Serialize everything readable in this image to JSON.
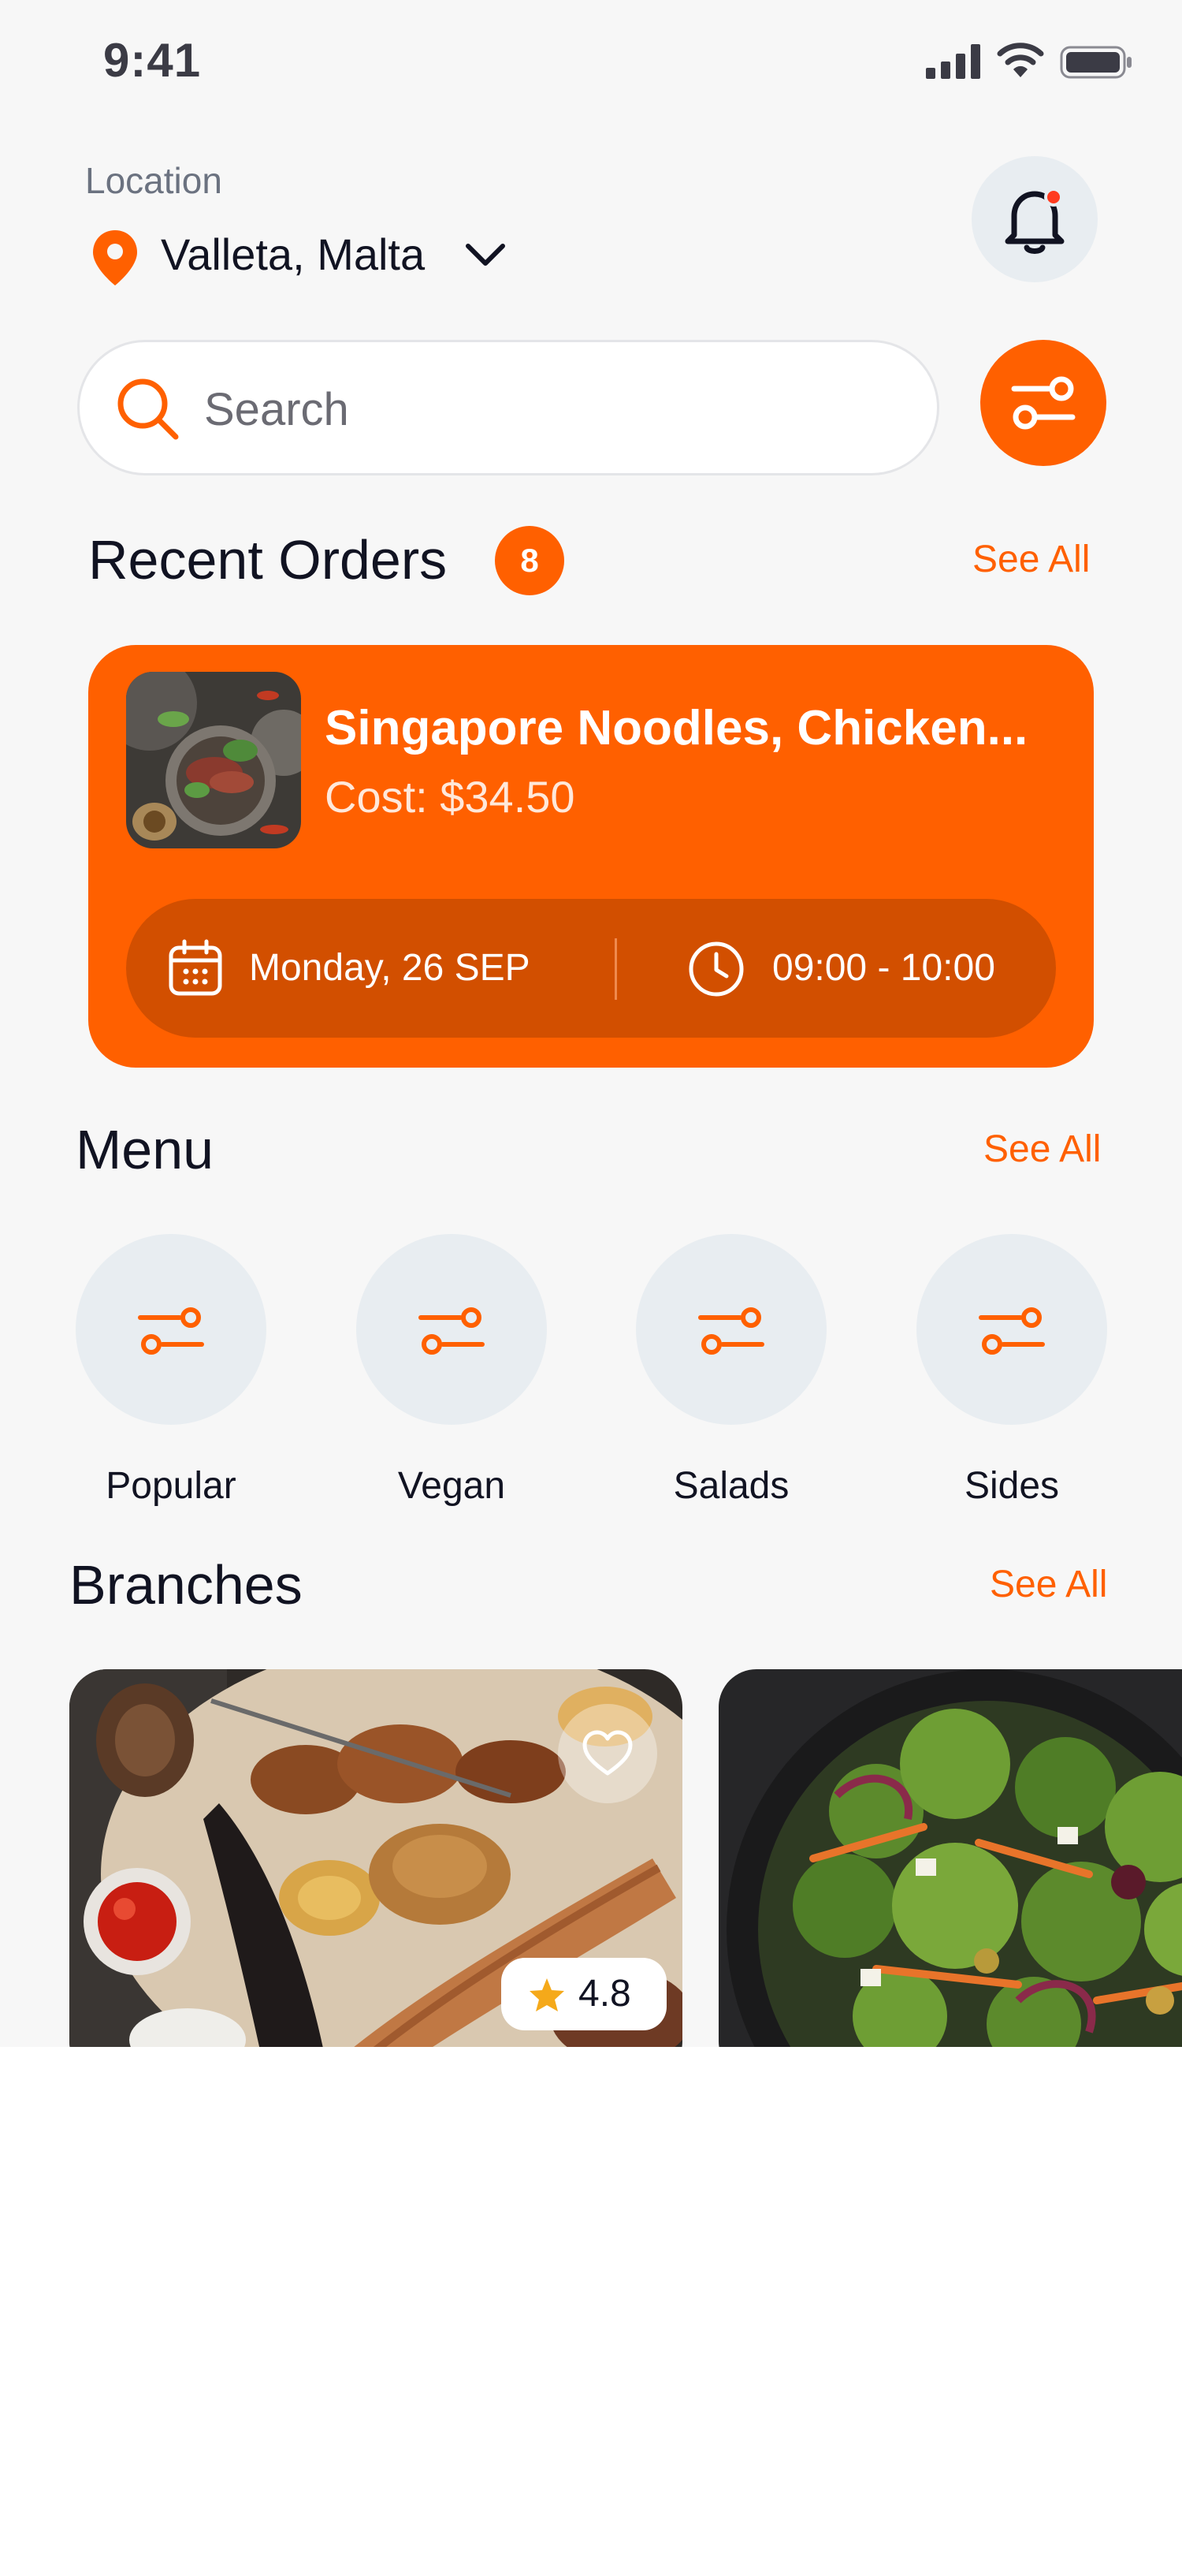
{
  "status_bar": {
    "time": "9:41"
  },
  "location": {
    "label": "Location",
    "value": "Valleta, Malta"
  },
  "search": {
    "placeholder": "Search"
  },
  "recent_orders": {
    "title": "Recent Orders",
    "count": "8",
    "see_all": "See All",
    "order": {
      "title": "Singapore Noodles, Chicken...",
      "cost": "Cost: $34.50",
      "date": "Monday, 26 SEP",
      "time": "09:00 - 10:00"
    }
  },
  "menu": {
    "title": "Menu",
    "see_all": "See All",
    "items": [
      {
        "label": "Popular"
      },
      {
        "label": "Vegan"
      },
      {
        "label": "Salads"
      },
      {
        "label": "Sides"
      }
    ]
  },
  "branches": {
    "title": "Branches",
    "see_all": "See All",
    "cards": [
      {
        "rating": "4.8"
      }
    ]
  },
  "colors": {
    "accent": "#ff6000",
    "accent_dark": "#d24f00",
    "chip_bg": "#e8edf1",
    "background": "#f7f7f7"
  },
  "icons": [
    "signal-icon",
    "wifi-icon",
    "battery-icon",
    "location-pin-icon",
    "chevron-down-icon",
    "bell-icon",
    "search-icon",
    "filter-icon",
    "calendar-icon",
    "clock-icon",
    "heart-icon",
    "star-icon"
  ]
}
